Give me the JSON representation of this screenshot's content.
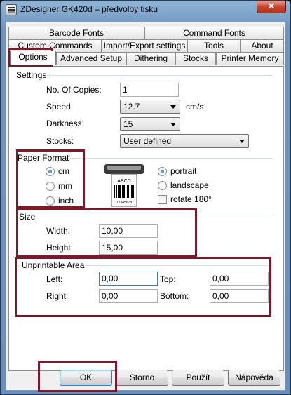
{
  "window": {
    "title": "ZDesigner GK420d – předvolby tisku",
    "close_glyph": "✕"
  },
  "tabs": {
    "row1": [
      "Barcode Fonts",
      "Command Fonts"
    ],
    "row2": [
      "Custom Commands",
      "Import/Export settings",
      "Tools",
      "About"
    ],
    "row3": [
      "Options",
      "Advanced Setup",
      "Dithering",
      "Stocks",
      "Printer Memory"
    ],
    "active": "Options"
  },
  "settings": {
    "group_title": "Settings",
    "copies_label": "No. Of Copies:",
    "copies_value": "1",
    "speed_label": "Speed:",
    "speed_value": "12.7",
    "speed_unit": "cm/s",
    "darkness_label": "Darkness:",
    "darkness_value": "15",
    "stocks_label": "Stocks:",
    "stocks_value": "User defined"
  },
  "paper_format": {
    "group_title": "Paper Format",
    "units": [
      "cm",
      "mm",
      "inch"
    ],
    "selected_unit": "cm",
    "orientation": [
      "portrait",
      "landscape"
    ],
    "selected_orientation": "portrait",
    "rotate_label": "rotate 180°",
    "rotate_checked": false,
    "icon_label": "ABCD",
    "icon_number": "12345678"
  },
  "size": {
    "group_title": "Size",
    "width_label": "Width:",
    "width_value": "10,00",
    "height_label": "Height:",
    "height_value": "15,00"
  },
  "unprintable": {
    "group_title": "Unprintable Area",
    "left_label": "Left:",
    "left_value": "0,00",
    "top_label": "Top:",
    "top_value": "0,00",
    "right_label": "Right:",
    "right_value": "0,00",
    "bottom_label": "Bottom:",
    "bottom_value": "0,00"
  },
  "buttons": {
    "ok": "OK",
    "cancel": "Storno",
    "apply": "Použít",
    "help": "Nápověda"
  },
  "colors": {
    "highlight": "#7b1a2a",
    "titlebar": "#8fb4d6",
    "close": "#c9452f"
  }
}
